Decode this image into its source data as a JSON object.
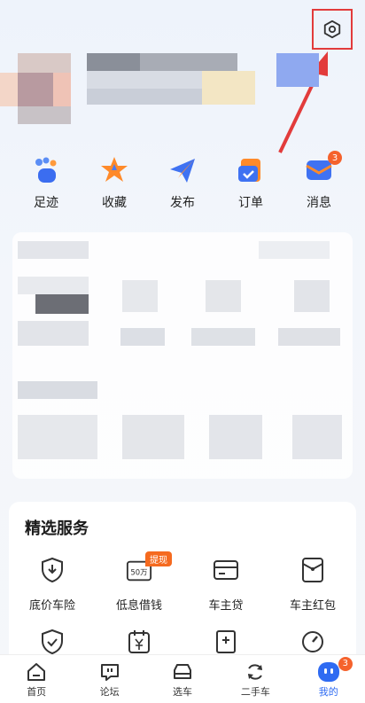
{
  "quick_actions": [
    {
      "label": "足迹",
      "icon": "footprint-icon"
    },
    {
      "label": "收藏",
      "icon": "star-icon"
    },
    {
      "label": "发布",
      "icon": "paper-plane-icon"
    },
    {
      "label": "订单",
      "icon": "order-icon"
    },
    {
      "label": "消息",
      "icon": "message-icon",
      "badge": "3"
    }
  ],
  "services": {
    "title": "精选服务",
    "items": [
      {
        "label": "底价车险",
        "icon": "shield-down-icon"
      },
      {
        "label": "低息借钱",
        "icon": "calendar-50-icon",
        "tag": "提现",
        "icon_text": "50万"
      },
      {
        "label": "车主贷",
        "icon": "card-icon"
      },
      {
        "label": "车主红包",
        "icon": "red-envelope-icon"
      },
      {
        "label": "",
        "icon": "shield-check-icon"
      },
      {
        "label": "",
        "icon": "calendar-yen-icon"
      },
      {
        "label": "",
        "icon": "document-plus-icon"
      },
      {
        "label": "",
        "icon": "speedometer-icon"
      }
    ]
  },
  "bottom_nav": [
    {
      "label": "首页",
      "icon": "home-icon"
    },
    {
      "label": "论坛",
      "icon": "forum-icon"
    },
    {
      "label": "选车",
      "icon": "car-icon"
    },
    {
      "label": "二手车",
      "icon": "recycle-icon"
    },
    {
      "label": "我的",
      "icon": "profile-icon",
      "active": true,
      "badge": "3"
    }
  ],
  "colors": {
    "accent": "#2f6bf2",
    "badge": "#f5622c",
    "annotation": "#e23b3b"
  }
}
